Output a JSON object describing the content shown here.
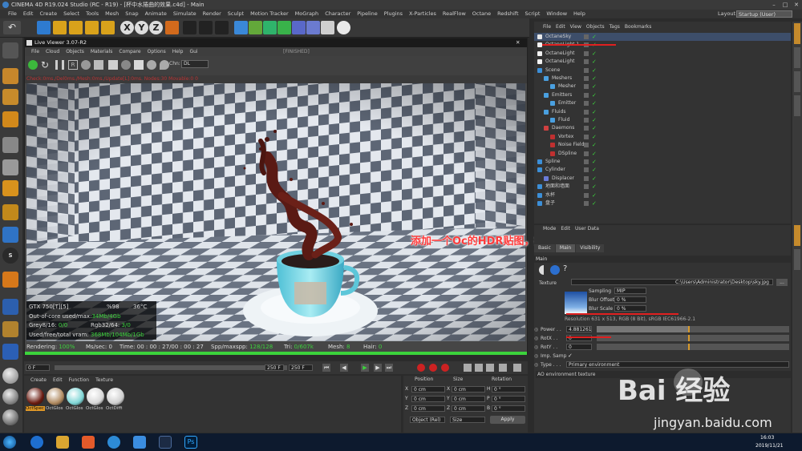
{
  "window": {
    "title": "CINEMA 4D R19.024 Studio (RC - R19) - [杯中水捲曲的效果.c4d] - Main",
    "layout_label": "Layout:",
    "layout_value": "Startup (User)"
  },
  "menubar": [
    "File",
    "Edit",
    "Create",
    "Select",
    "Tools",
    "Mesh",
    "Snap",
    "Animate",
    "Simulate",
    "Render",
    "Sculpt",
    "Motion Tracker",
    "MoGraph",
    "Character",
    "Pipeline",
    "Plugins",
    "X-Particles",
    "RealFlow",
    "Octane",
    "Redshift",
    "Script",
    "Window",
    "Help"
  ],
  "live_viewer": {
    "title": "Live Viewer 3.07-R2",
    "menu": [
      "File",
      "Cloud",
      "Objects",
      "Materials",
      "Compare",
      "Options",
      "Help",
      "Gui"
    ],
    "state": "[FINISHED]",
    "channel_label": "Chn:",
    "channel_value": "DL",
    "status_line": "Check:0ms./Del0ms./Mesh:0ms./Update[L]:0ms. Nodes:30 Movable:0 0",
    "hud": {
      "gpu": "GTX 750[T][5]",
      "gpu_pct": "%98",
      "gpu_temp": "36°C",
      "ooc_label": "Out-of-core used/max:",
      "ooc_value": "34Mb/4Gb",
      "grey_label": "Grey8/16:",
      "grey_value": "0/0",
      "rgb_label": "Rgb32/64:",
      "rgb_value": "3/0",
      "vram_label": "Used/free/total vram:",
      "vram_value": "368Mb/104Mb/1Gb"
    },
    "render_status": {
      "rendering_label": "Rendering:",
      "rendering_value": "100%",
      "ms_label": "Ms/sec:",
      "ms_value": "0",
      "time_label": "Time:",
      "time_value": "00 : 00 : 27/00 : 00 : 27",
      "spp_label": "Spp/maxspp:",
      "spp_value": "128/128",
      "tri_label": "Tri:",
      "tri_value": "0/607k",
      "mesh_label": "Mesh:",
      "mesh_value": "8",
      "hair_label": "Hair:",
      "hair_value": "0"
    }
  },
  "timeline": {
    "start": "0 F",
    "end": "250 F",
    "end2": "250 F",
    "cur": "0 F"
  },
  "material_panel": {
    "menu": [
      "Create",
      "Edit",
      "Function",
      "Texture"
    ],
    "materials": [
      {
        "label": "OctSpec",
        "color": "#6b1b10",
        "selected": true
      },
      {
        "label": "OctGlos",
        "color": "#b08a60",
        "selected": false
      },
      {
        "label": "OctGlos",
        "color": "#7fd6d6",
        "selected": false
      },
      {
        "label": "OctGlos",
        "color": "#d8d8d8",
        "selected": false
      },
      {
        "label": "OctDiffi",
        "color": "#cfcfcf",
        "selected": false
      }
    ]
  },
  "coordinates": {
    "headers": [
      "Position",
      "Size",
      "Rotation"
    ],
    "rows": [
      {
        "axis": "X",
        "pos": "0 cm",
        "size": "0 cm",
        "rot_label": "H",
        "rot": "0 °"
      },
      {
        "axis": "Y",
        "pos": "0 cm",
        "size": "0 cm",
        "rot_label": "P",
        "rot": "0 °"
      },
      {
        "axis": "Z",
        "pos": "0 cm",
        "size": "0 cm",
        "rot_label": "B",
        "rot": "0 °"
      }
    ],
    "mode": "Object (Rel)",
    "size_mode": "Size",
    "apply": "Apply"
  },
  "object_manager": {
    "menu": [
      "File",
      "Edit",
      "View",
      "Objects",
      "Tags",
      "Bookmarks"
    ],
    "objects": [
      {
        "name": "OctaneSky",
        "indent": 0,
        "selected": true
      },
      {
        "name": "OctaneLight.1",
        "indent": 0,
        "selected": false
      },
      {
        "name": "OctaneLight",
        "indent": 0,
        "selected": false
      },
      {
        "name": "OctaneLight",
        "indent": 0,
        "selected": false
      },
      {
        "name": "Scene",
        "indent": 0,
        "selected": false
      },
      {
        "name": "Meshers",
        "indent": 1,
        "selected": false
      },
      {
        "name": "Mesher",
        "indent": 2,
        "selected": false
      },
      {
        "name": "Emitters",
        "indent": 1,
        "selected": false
      },
      {
        "name": "Emitter",
        "indent": 2,
        "selected": false
      },
      {
        "name": "Fluids",
        "indent": 1,
        "selected": false
      },
      {
        "name": "Fluid",
        "indent": 2,
        "selected": false
      },
      {
        "name": "Daemons",
        "indent": 1,
        "selected": false
      },
      {
        "name": "Vortex",
        "indent": 2,
        "selected": false
      },
      {
        "name": "Noise Field",
        "indent": 2,
        "selected": false
      },
      {
        "name": "DSpline",
        "indent": 2,
        "selected": false
      },
      {
        "name": "Spline",
        "indent": 0,
        "selected": false
      },
      {
        "name": "Cylinder",
        "indent": 0,
        "selected": false
      },
      {
        "name": "Displacer",
        "indent": 1,
        "selected": false
      },
      {
        "name": "地面和墙面",
        "indent": 0,
        "selected": false
      },
      {
        "name": "水杯",
        "indent": 0,
        "selected": false
      },
      {
        "name": "盘子",
        "indent": 0,
        "selected": false
      }
    ]
  },
  "attribute_manager": {
    "menu": [
      "Mode",
      "Edit",
      "User Data"
    ],
    "tabs": [
      "Basic",
      "Main",
      "Visibility"
    ],
    "section": "Main",
    "texture_label": "Texture",
    "texture_path": "C:\\Users\\Administrator\\Desktop\\sky.jpg",
    "sampling_label": "Sampling",
    "sampling_value": "MIP",
    "blur_offset_label": "Blur Offset",
    "blur_offset_value": "0 %",
    "blur_scale_label": "Blur Scale",
    "blur_scale_value": "0 %",
    "resolution": "Resolution 631 x 513, RGB (8 Bit), sRGB IEC61966-2.1",
    "power_label": "Power . .",
    "power_value": "4.881261",
    "rotx_label": "RotX . .",
    "rotx_value": "0",
    "roty_label": "RotY . .",
    "roty_value": "0",
    "imp_label": "Imp. Samp",
    "type_label": "Type . . .",
    "type_value": "Primary environment",
    "ao_label": "AO environment texture"
  },
  "annotation": "添加一个Oc的HDR贴图，把天空图加进去，目的是让水反射光更真实。",
  "watermark": {
    "text": "Bai 经验",
    "url": "jingyan.baidu.com"
  },
  "taskbar": {
    "time": "16:03",
    "date": "2019/11/21"
  }
}
